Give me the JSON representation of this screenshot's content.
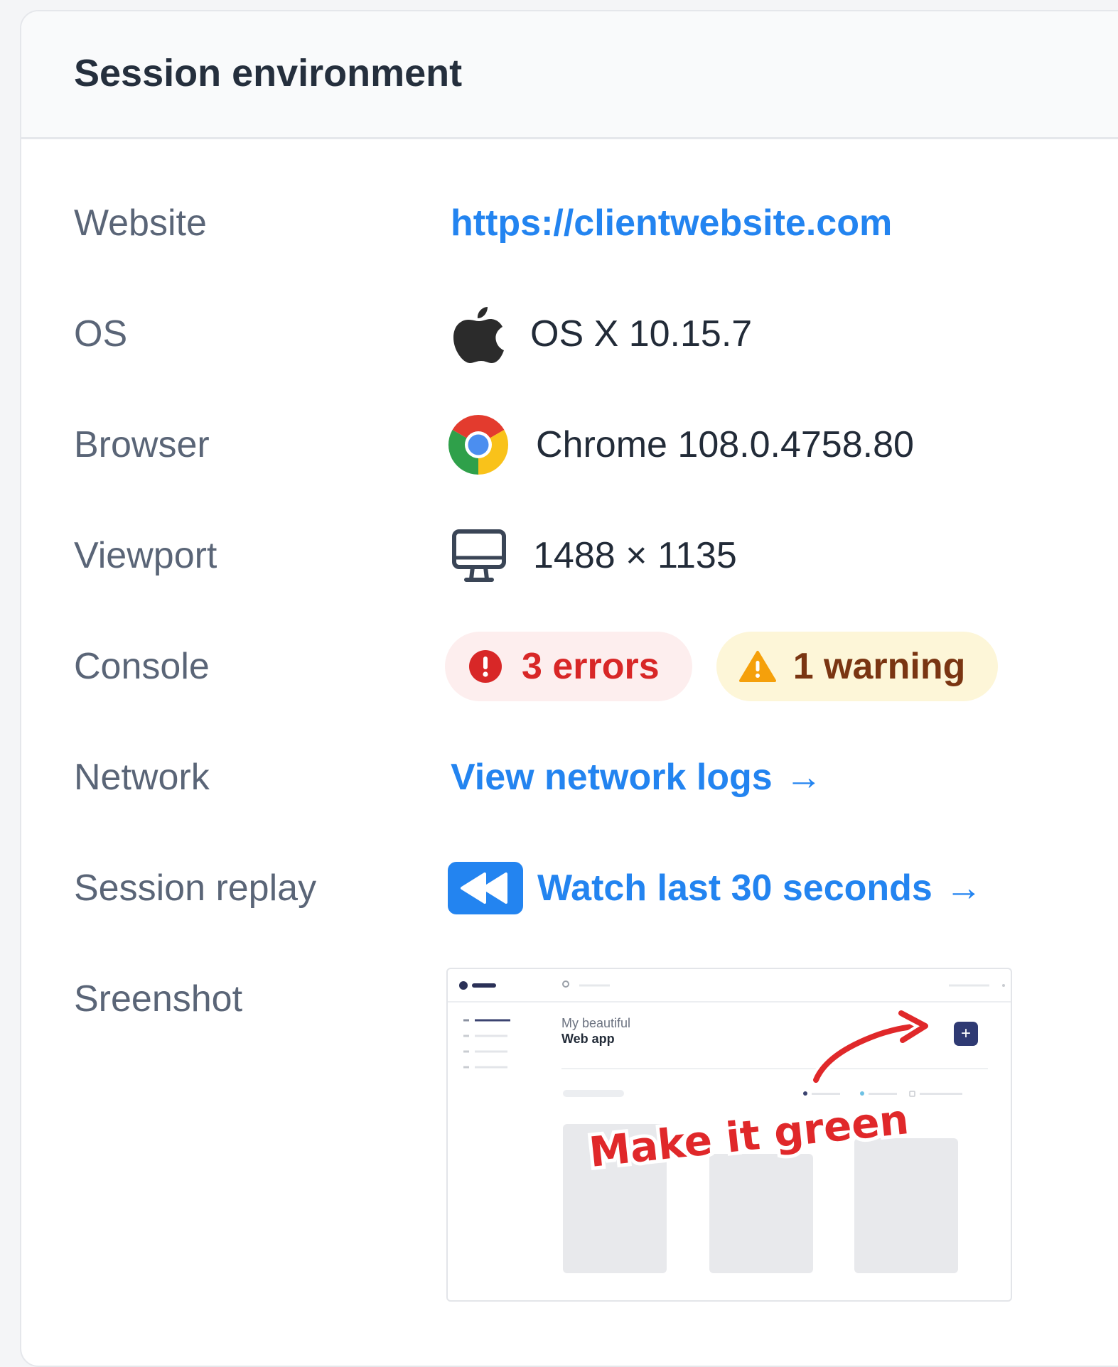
{
  "panel": {
    "title": "Session environment"
  },
  "rows": {
    "website": {
      "label": "Website",
      "value": "https://clientwebsite.com"
    },
    "os": {
      "label": "OS",
      "icon": "apple-icon",
      "value": "OS X 10.15.7"
    },
    "browser": {
      "label": "Browser",
      "icon": "chrome-icon",
      "value": "Chrome 108.0.4758.80"
    },
    "viewport": {
      "label": "Viewport",
      "icon": "monitor-icon",
      "value": "1488 × 1135"
    },
    "console": {
      "label": "Console",
      "errors": {
        "icon": "error-icon",
        "text": "3 errors"
      },
      "warnings": {
        "icon": "warning-icon",
        "text": "1 warning"
      }
    },
    "network": {
      "label": "Network",
      "link": "View network logs",
      "arrow": "→"
    },
    "replay": {
      "label": "Session replay",
      "icon": "rewind-icon",
      "link": "Watch last 30 seconds",
      "arrow": "→"
    },
    "screenshot": {
      "label": "Sreenshot",
      "preview": {
        "app_title_line1": "My beautiful",
        "app_title_line2": "Web app",
        "annotation": "Make it green",
        "plus": "+"
      }
    }
  },
  "colors": {
    "link": "#2384f0",
    "error_bg": "#fdeeee",
    "error_text": "#d82727",
    "warning_bg": "#fdf6d8",
    "warning_text": "#7a3512",
    "warning_icon": "#f5a00b",
    "annotation": "#e0282a"
  }
}
